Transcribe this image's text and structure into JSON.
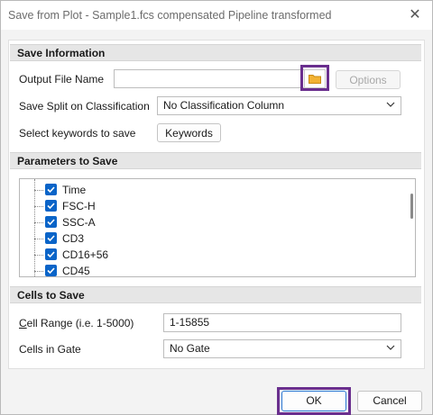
{
  "window": {
    "title": "Save from Plot - Sample1.fcs compensated Pipeline transformed",
    "close_glyph": "✕"
  },
  "save_information": {
    "header": "Save Information",
    "output_file_name_label": "Output File Name",
    "output_file_name_value": "",
    "browse_icon": "folder-icon",
    "options_label": "Options",
    "split_label": "Save Split on Classification",
    "split_value": "No Classification Column",
    "keywords_label": "Select keywords to save",
    "keywords_button": "Keywords"
  },
  "parameters": {
    "header": "Parameters to Save",
    "items": [
      {
        "label": "Time",
        "checked": true
      },
      {
        "label": "FSC-H",
        "checked": true
      },
      {
        "label": "SSC-A",
        "checked": true
      },
      {
        "label": "CD3",
        "checked": true
      },
      {
        "label": "CD16+56",
        "checked": true
      },
      {
        "label": "CD45",
        "checked": true
      }
    ]
  },
  "cells": {
    "header": "Cells to Save",
    "range_label_mnemonic": "C",
    "range_label_rest": "ell Range (i.e. 1-5000)",
    "range_value": "1-15855",
    "gate_label": "Cells in Gate",
    "gate_value": "No Gate"
  },
  "footer": {
    "ok": "OK",
    "cancel": "Cancel"
  },
  "colors": {
    "accent": "#0a64c8",
    "highlight": "#6a2f8e",
    "folder": "#f2b233"
  }
}
